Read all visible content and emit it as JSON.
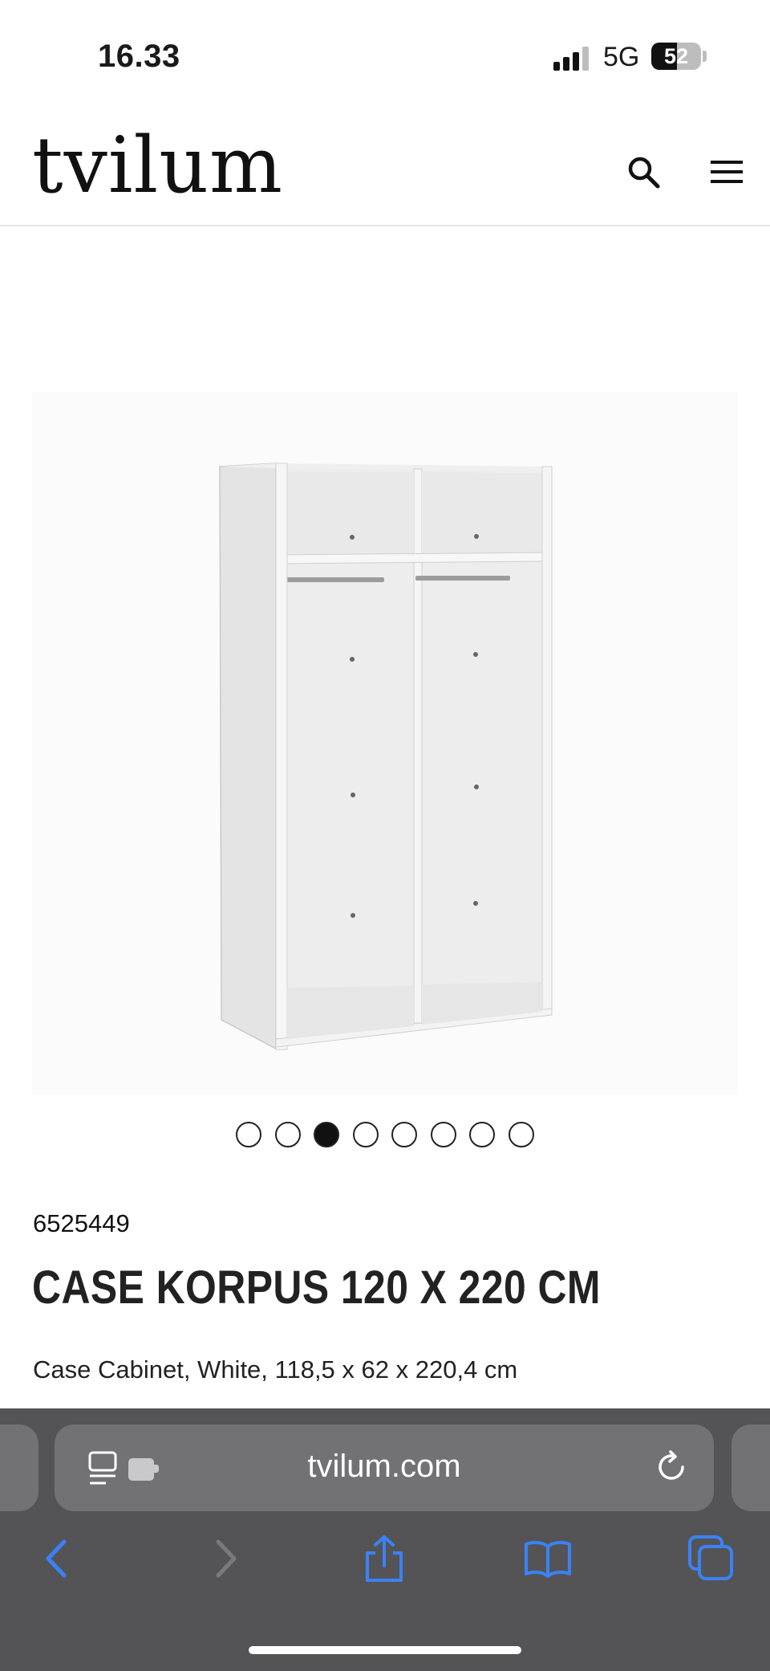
{
  "status_bar": {
    "time": "16.33",
    "network": "5G",
    "battery_percent": "52",
    "battery_level": 0.52,
    "signal_bars_active": 3
  },
  "header": {
    "logo": "tvilum",
    "search_icon": "search-icon",
    "menu_icon": "hamburger-menu-icon"
  },
  "gallery": {
    "image_count": 8,
    "active_index": 2,
    "image_alt": "wardrobe-cabinet-image"
  },
  "product": {
    "sku": "6525449",
    "title": "CASE KORPUS 120 X 220 CM",
    "description": "Case Cabinet, White, 118,5 x 62 x 220,4 cm"
  },
  "browser": {
    "url": "tvilum.com",
    "toolbar": [
      "back-icon",
      "forward-icon",
      "share-icon",
      "bookmarks-icon",
      "tabs-icon"
    ],
    "accent_color": "#3b82f6",
    "disabled_color": "#7a7a7c"
  }
}
